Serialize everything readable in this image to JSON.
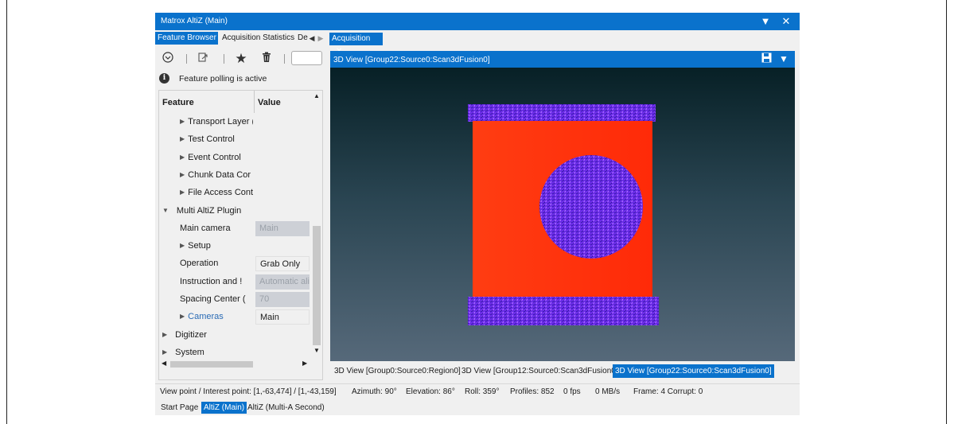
{
  "window": {
    "title": "Matrox AltiZ (Main)",
    "pin_icon": "dropdown-triangle",
    "close_icon": "close-x"
  },
  "left_tabs": [
    {
      "label": "Feature Browser",
      "active": true
    },
    {
      "label": "Acquisition Statistics",
      "active": false
    },
    {
      "label": "De",
      "active": false
    }
  ],
  "toolbar": {
    "icons": [
      "circle-chevron-down",
      "export-icon",
      "star-icon",
      "trash-icon"
    ],
    "search_value": ""
  },
  "info_text": "Feature polling is active",
  "grid": {
    "col_feature": "Feature",
    "col_value": "Value",
    "rows": [
      {
        "label": "Transport Layer (",
        "value": null,
        "indent": 1,
        "expander": "collapsed"
      },
      {
        "label": "Test Control",
        "value": null,
        "indent": 1,
        "expander": "collapsed"
      },
      {
        "label": "Event Control",
        "value": null,
        "indent": 1,
        "expander": "collapsed"
      },
      {
        "label": "Chunk Data Cor",
        "value": null,
        "indent": 1,
        "expander": "collapsed"
      },
      {
        "label": "File Access Cont",
        "value": null,
        "indent": 1,
        "expander": "collapsed"
      },
      {
        "label": "Multi AltiZ Plugin",
        "value": null,
        "indent": 0,
        "expander": "expanded"
      },
      {
        "label": "Main camera",
        "value": "Main",
        "indent": 1,
        "expander": "none",
        "readonly": true
      },
      {
        "label": "Setup",
        "value": null,
        "indent": 1,
        "expander": "collapsed"
      },
      {
        "label": "Operation",
        "value": "Grab Only",
        "indent": 1,
        "expander": "none",
        "readonly": false
      },
      {
        "label": "Instruction and !",
        "value": "Automatic ali",
        "indent": 1,
        "expander": "none",
        "readonly": true
      },
      {
        "label": "Spacing Center (",
        "value": "70",
        "indent": 1,
        "expander": "none",
        "readonly": true
      },
      {
        "label": "Cameras",
        "value": "Main",
        "indent": 1,
        "expander": "collapsed",
        "readonly": false,
        "link": true
      },
      {
        "label": "Digitizer",
        "value": null,
        "indent": 0,
        "expander": "collapsed"
      },
      {
        "label": "System",
        "value": null,
        "indent": 0,
        "expander": "collapsed"
      }
    ]
  },
  "acquisition_tab": "Acquisition",
  "view_title": "3D View [Group22:Source0:Scan3dFusion0]",
  "view_tabs": [
    {
      "label": "3D View [Group0:Source0:Region0]",
      "active": false
    },
    {
      "label": "3D View [Group12:Source0:Scan3dFusion0]",
      "active": false
    },
    {
      "label": "3D View [Group22:Source0:Scan3dFusion0]",
      "active": true
    }
  ],
  "status": {
    "viewpoint": "View point / Interest point: [1,-63,474] / [1,-43,159]",
    "azimuth": "Azimuth: 90°",
    "elevation": "Elevation: 86°",
    "roll": "Roll: 359°",
    "profiles": "Profiles: 852",
    "fps": "0 fps",
    "mbs": "0 MB/s",
    "frame": "Frame: 4 Corrupt: 0"
  },
  "doc_tabs": [
    {
      "label": "Start Page",
      "active": false
    },
    {
      "label": "AltiZ (Main)",
      "active": true
    },
    {
      "label": "AltiZ (Multi-A Second)",
      "active": false
    }
  ],
  "colors": {
    "accent": "#0a72cc",
    "surface_red": "#ff3a12",
    "point_purple": "#7733ee"
  }
}
